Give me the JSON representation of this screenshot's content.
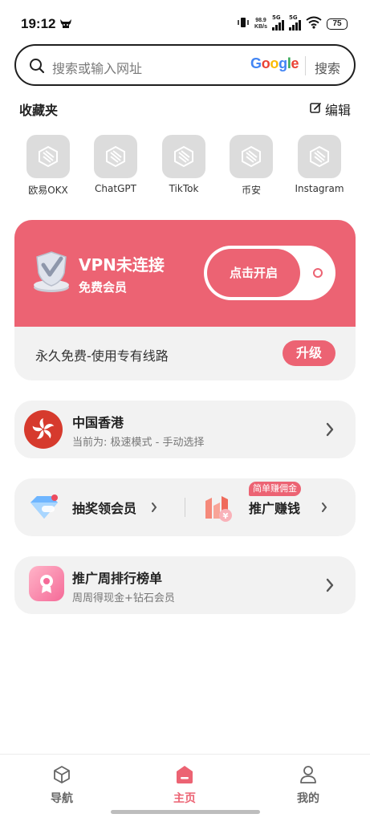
{
  "status_bar": {
    "time": "19:12",
    "net_speed_value": "98.9",
    "net_speed_unit": "KB/s",
    "sim1": "5G",
    "sim2": "5G",
    "battery": "75"
  },
  "search": {
    "placeholder": "搜索或输入网址",
    "engine": "Google",
    "button_label": "搜索"
  },
  "favorites": {
    "title": "收藏夹",
    "edit_label": "编辑",
    "items": [
      {
        "label": "欧易OKX",
        "icon": "placeholder-logo-icon"
      },
      {
        "label": "ChatGPT",
        "icon": "placeholder-logo-icon"
      },
      {
        "label": "TikTok",
        "icon": "placeholder-logo-icon"
      },
      {
        "label": "币安",
        "icon": "placeholder-logo-icon"
      },
      {
        "label": "Instagram",
        "icon": "placeholder-logo-icon"
      }
    ]
  },
  "vpn": {
    "status": "VPN未连接",
    "membership": "免费会员",
    "toggle_label": "点击开启",
    "free_line_text": "永久免费-使用专有线路",
    "upgrade_label": "升级",
    "accent_color": "#ec6373"
  },
  "region": {
    "title": "中国香港",
    "subtitle": "当前为: 极速模式 - 手动选择",
    "icon": "hong-kong-flag-icon"
  },
  "promo": {
    "lottery_label": "抽奖领会员",
    "promote_label": "推广赚钱",
    "promote_badge": "简单赚佣金"
  },
  "ranking": {
    "title": "推广周排行榜单",
    "subtitle": "周周得现金+钻石会员"
  },
  "bottom_nav": {
    "items": [
      {
        "label": "导航",
        "icon": "cube-icon",
        "active": false
      },
      {
        "label": "主页",
        "icon": "home-icon",
        "active": true
      },
      {
        "label": "我的",
        "icon": "user-icon",
        "active": false
      }
    ]
  }
}
